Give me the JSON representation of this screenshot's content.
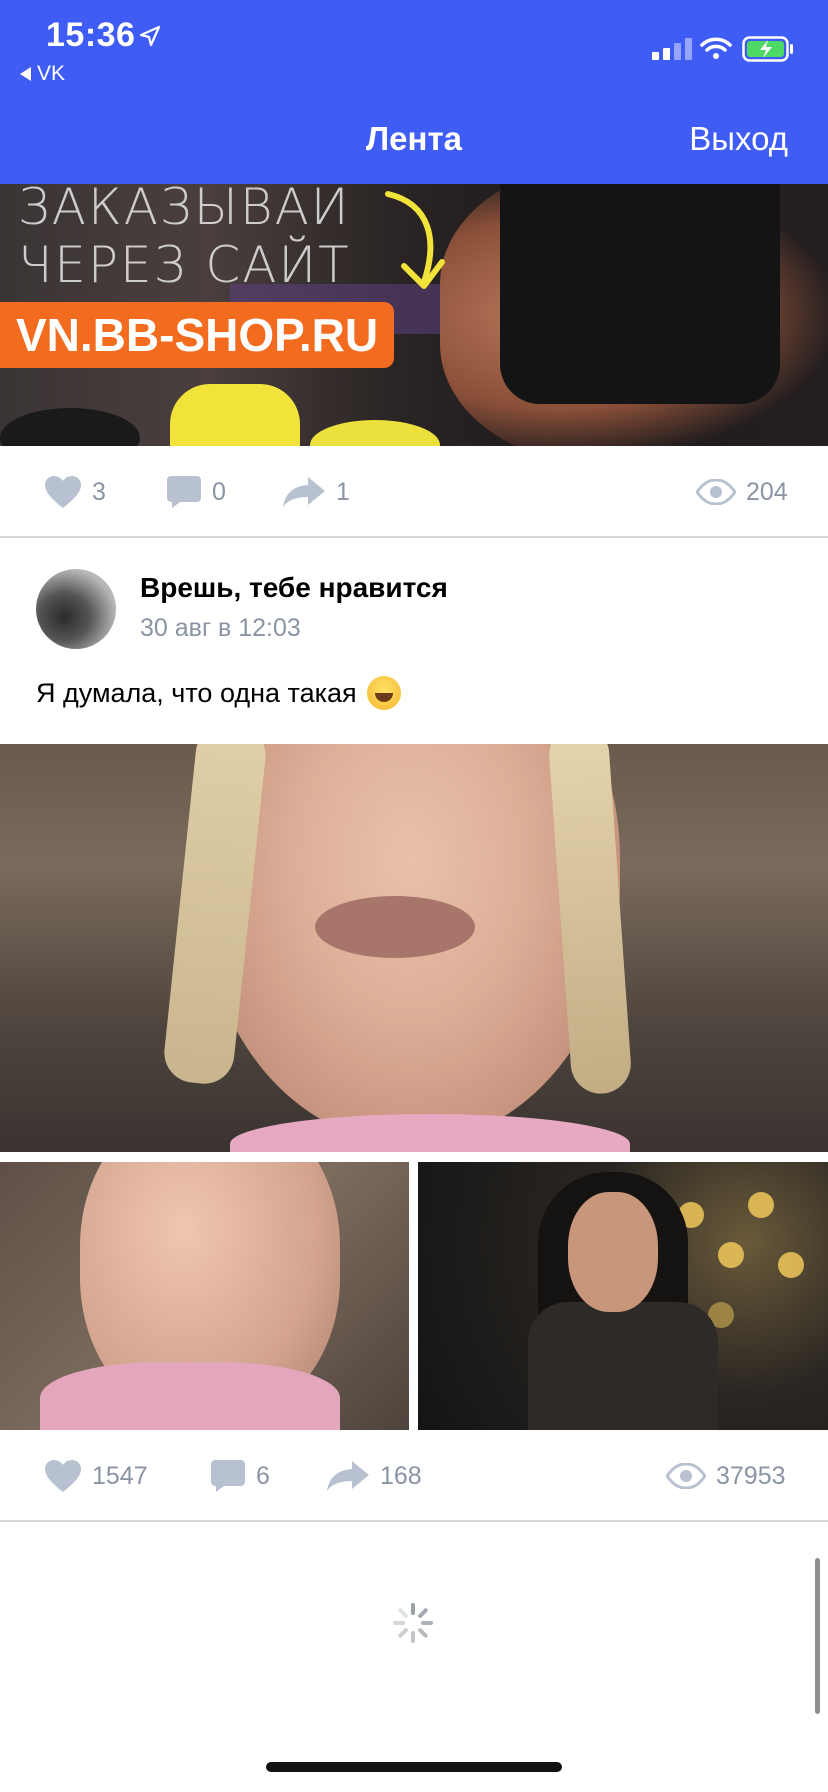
{
  "status_bar": {
    "time": "15:36",
    "back_app": "VK"
  },
  "nav": {
    "title": "Лента",
    "logout_label": "Выход"
  },
  "ad_post": {
    "banner_line1": "ЗАКАЗЫВАЙ",
    "banner_line2": "ЧЕРЕЗ САЙТ",
    "banner_site": "VN.BB-SHOP.RU",
    "likes": "3",
    "comments": "0",
    "shares": "1",
    "views": "204"
  },
  "post": {
    "author": "Врешь, тебе нравится",
    "date": "30 авг в 12:03",
    "text": "Я думала, что одна такая",
    "emoji": "grinning-sweat-emoji",
    "likes": "1547",
    "comments": "6",
    "shares": "168",
    "views": "37953"
  },
  "colors": {
    "header_bg": "#3f5cf4",
    "muted": "#8a94a5",
    "ad_orange": "#f26b1f"
  }
}
